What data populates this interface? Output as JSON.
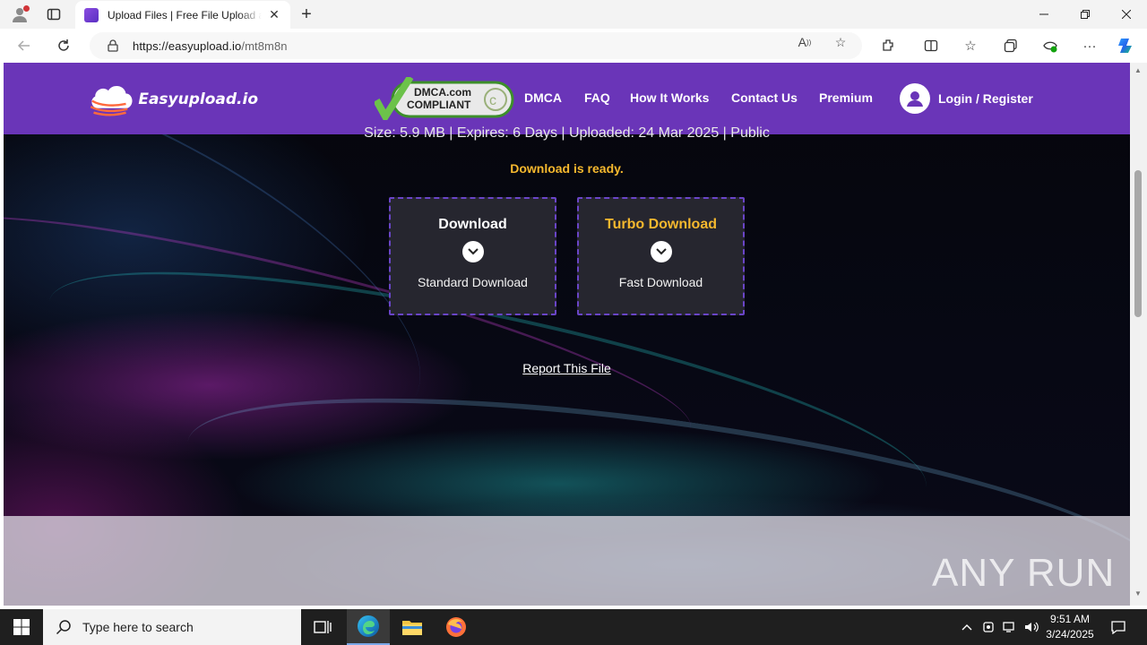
{
  "browser": {
    "tab_title": "Upload Files | Free File Upload and Sharing",
    "url_host": "https://easyupload.io",
    "url_path": "/mt8m8n",
    "new_tab_label": "+"
  },
  "site": {
    "logo_text": "Easyupload.io",
    "dmca_line1": "DMCA.com",
    "dmca_line2": "COMPLIANT",
    "nav": {
      "dmca": "DMCA",
      "faq": "FAQ",
      "how_it_works": "How It Works",
      "contact": "Contact Us",
      "premium": "Premium",
      "login": "Login / Register"
    }
  },
  "main": {
    "file_meta": "Size: 5.9 MB | Expires: 6 Days | Uploaded: 24 Mar 2025 | Public",
    "status": "Download is ready.",
    "standard": {
      "title": "Download",
      "subtitle": "Standard Download"
    },
    "turbo": {
      "title": "Turbo Download",
      "subtitle": "Fast Download"
    },
    "report": "Report This File"
  },
  "watermark": "ANY RUN",
  "taskbar": {
    "search_placeholder": "Type here to search",
    "time": "9:51 AM",
    "date": "3/24/2025"
  },
  "colors": {
    "header_purple": "#6a35b8",
    "accent_yellow": "#f5b82e",
    "box_border": "#6a45c8"
  }
}
